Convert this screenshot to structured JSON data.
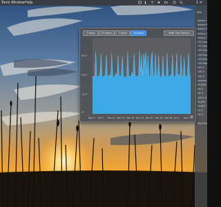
{
  "menubar": {
    "items": [
      "Tools",
      "Window",
      "Help"
    ],
    "right_text": "1 ≠"
  },
  "sidebar": {
    "title": "Tem",
    "items": [
      "Airflow l",
      "Airflow R",
      "Battery 1",
      "Battery 2",
      "Battery 3",
      "CPU Core",
      "CPU Heat",
      "CPU Prox",
      "CPU Prox",
      "CPU Prox",
      "GPU Prox",
      "GPU 1",
      "GPU 2",
      "GPU 3",
      "Ambient",
      "HD/SSD",
      "Fan 1",
      "Fan 2",
      "APPLE S",
      "St-MP3",
      "St-MP3",
      "Fan 1",
      "Fan 2"
    ],
    "footer": "Total Fan"
  },
  "popup": {
    "tabs": [
      "1 Hour",
      "24 Hours",
      "7 Days",
      "30 Days"
    ],
    "selected_tab": "30 Days",
    "hide_label": "Hide This Sensor",
    "settings_icon": "gear-icon"
  },
  "chart_data": {
    "type": "area",
    "title": "",
    "xlabel": "",
    "ylabel": "",
    "y_tick_labels": [
      "",
      "40.5°",
      "25.5°",
      "12.5°",
      "0°"
    ],
    "x_tick_labels": [
      "Dec 4",
      "Dec 7",
      "Dec 10",
      "Dec 13",
      "Dec 16",
      "Dec 19",
      "Dec 22",
      "Dec 25",
      "Dec 28",
      "Jan 1",
      "Jan 4"
    ],
    "ylim": [
      0,
      54
    ],
    "color": "#3aa9e6",
    "series": [
      {
        "values": [
          26,
          27,
          26,
          44,
          27,
          26,
          27,
          29,
          43,
          27,
          26,
          27,
          28,
          42,
          27,
          26,
          28,
          26,
          43,
          27,
          26,
          27,
          29,
          27,
          42,
          26,
          27,
          28,
          41,
          27,
          26,
          26,
          27,
          44,
          26,
          27,
          26,
          30,
          27,
          43,
          28,
          26,
          27,
          26,
          45,
          30,
          42,
          27,
          43,
          36,
          44,
          28,
          42,
          27,
          26,
          40,
          44,
          27,
          26,
          43,
          27,
          28,
          42,
          27,
          26,
          27,
          41,
          28,
          26,
          27,
          43,
          27,
          26,
          28,
          27,
          42,
          27,
          26,
          27,
          43,
          27,
          28,
          26,
          42,
          27,
          26,
          40,
          27,
          26,
          27,
          43,
          28,
          27
        ]
      }
    ]
  },
  "colors": {
    "accent": "#3d8ce0",
    "chart_fill": "#3aa9e6",
    "panel_bg": "#4e5054",
    "menubar_bg": "#3a3c40"
  }
}
